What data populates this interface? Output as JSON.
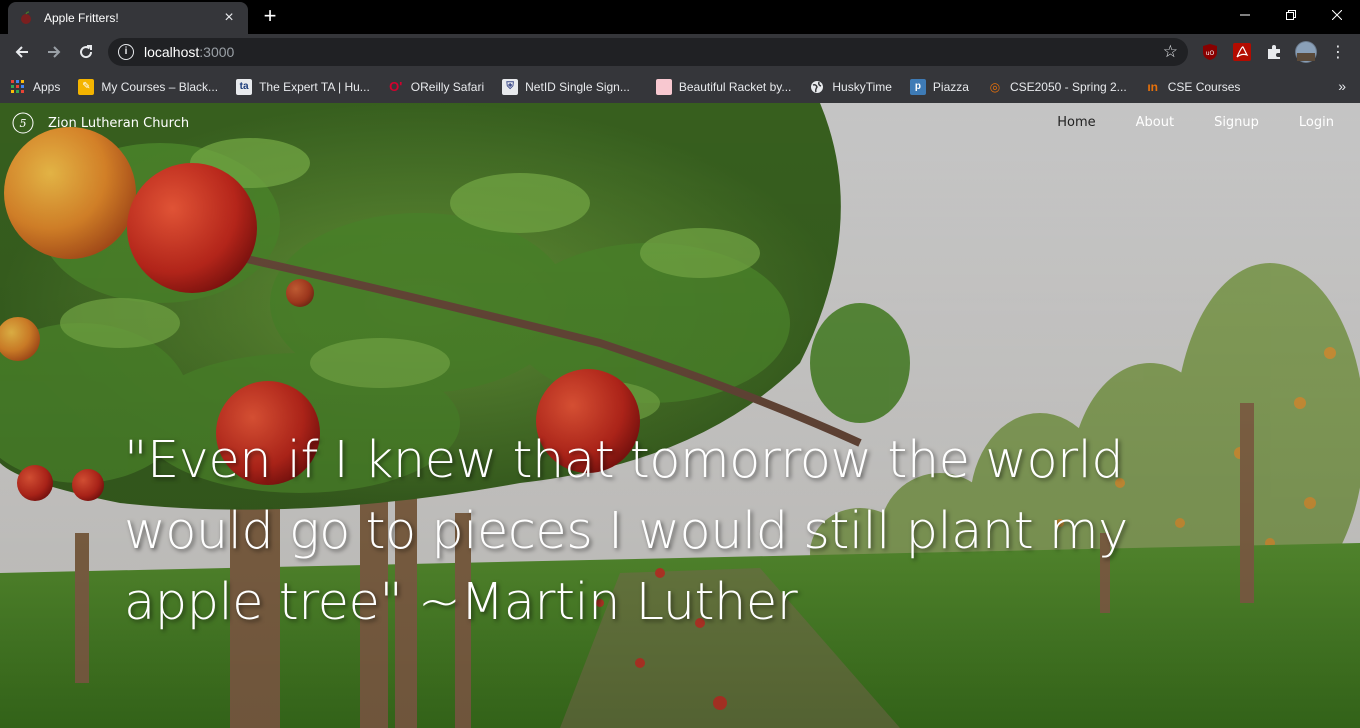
{
  "browser": {
    "tab": {
      "title": "Apple Fritters!",
      "close": "×"
    },
    "new_tab": "+",
    "window_controls": {
      "minimize": "—",
      "restore": "❐",
      "close": "✕"
    },
    "address": {
      "host": "localhost",
      "port": ":3000"
    },
    "nav": {
      "back": "←",
      "forward": "→",
      "reload": "⟳"
    },
    "bookmarks": [
      {
        "label": "Apps",
        "icon": "apps-grid-icon",
        "color": "#ea4335"
      },
      {
        "label": "My Courses – Black...",
        "icon": "blackboard-icon",
        "color": "#f4b400"
      },
      {
        "label": "The Expert TA | Hu...",
        "icon": "expert-ta-icon",
        "color": "#1a73e8"
      },
      {
        "label": "OReilly Safari",
        "icon": "oreilly-icon",
        "color": "#d3002d"
      },
      {
        "label": "NetID Single Sign...",
        "icon": "netid-icon",
        "color": "#3c4a8a"
      },
      {
        "label": "Beautiful Racket by...",
        "icon": "racket-icon",
        "color": "#f8c8d0"
      },
      {
        "label": "HuskyTime",
        "icon": "globe-icon",
        "color": "#e8eaed"
      },
      {
        "label": "Piazza",
        "icon": "piazza-icon",
        "color": "#3e7bb6"
      },
      {
        "label": "CSE2050 - Spring 2...",
        "icon": "cse2050-icon",
        "color": "#e8710a"
      },
      {
        "label": "CSE Courses",
        "icon": "cse-courses-icon",
        "color": "#e8710a"
      }
    ],
    "more": "»"
  },
  "page": {
    "brand": "Zion Lutheran Church",
    "nav": [
      "Home",
      "About",
      "Signup",
      "Login"
    ],
    "active_nav": "Home",
    "quote": "\"Even if I knew that tomorrow the world would go to pieces I would still plant my apple tree\" ~Martin Luther"
  }
}
